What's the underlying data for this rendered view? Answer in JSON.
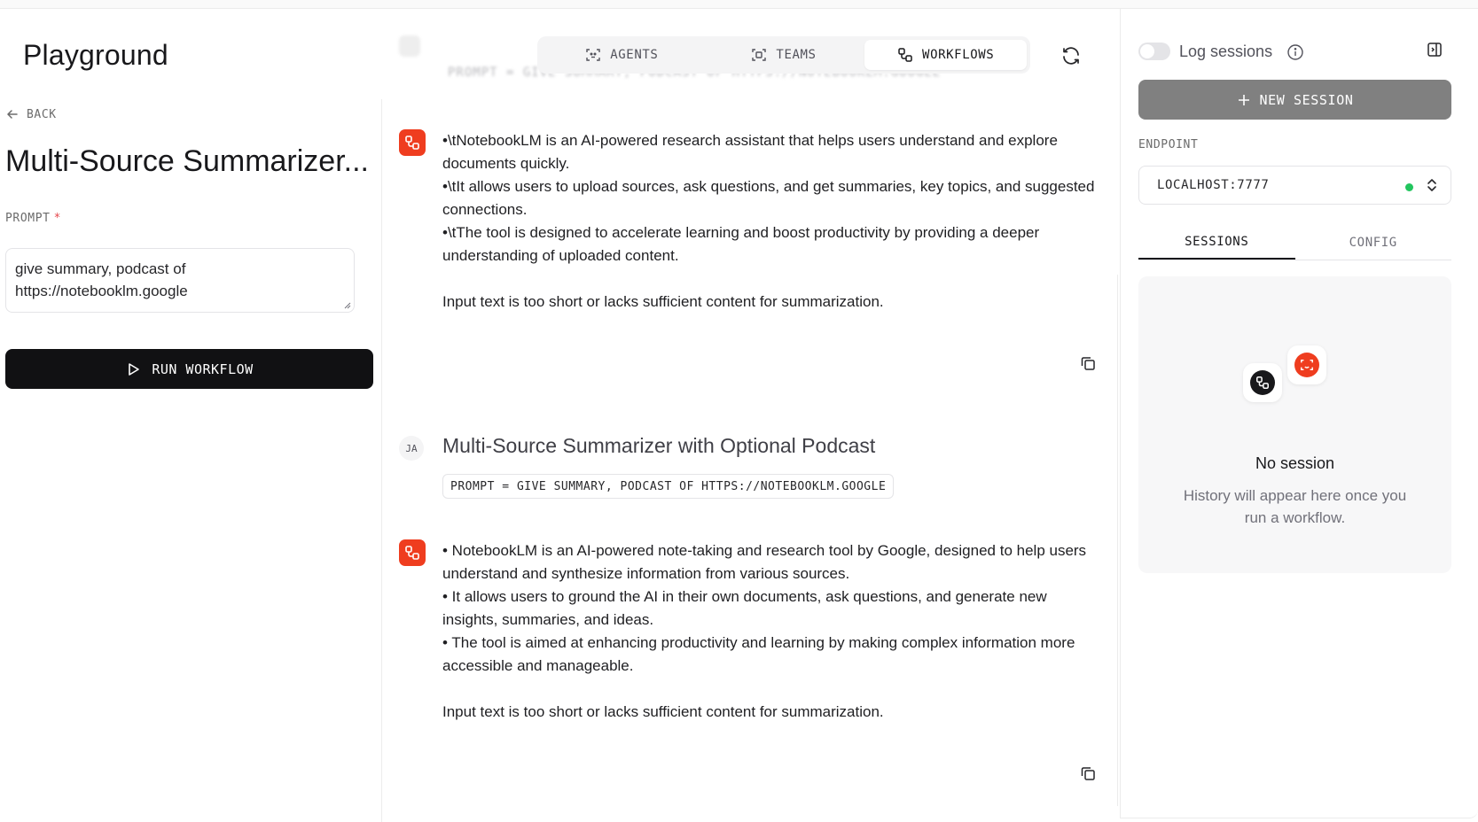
{
  "app": {
    "title": "Playground"
  },
  "left": {
    "back_label": "BACK",
    "workflow_title": "Multi-Source Summarizer...",
    "prompt_label": "PROMPT",
    "prompt_required_mark": "*",
    "prompt_value_line1": "give summary, podcast of",
    "prompt_value_line2": "https://notebooklm.google",
    "run_button_label": "RUN WORKFLOW"
  },
  "tabs": [
    {
      "label": "AGENTS",
      "icon": "agent-icon",
      "active": false
    },
    {
      "label": "TEAMS",
      "icon": "team-icon",
      "active": false
    },
    {
      "label": "WORKFLOWS",
      "icon": "workflow-icon",
      "active": true
    }
  ],
  "chat": {
    "ghost_text": "PROMPT = GIVE SUMMARY, PODCAST OF HTTPS://NOTEBOOKLM.GOOGLE",
    "response1": [
      "•\\tNotebookLM is an AI-powered research assistant that helps users understand and explore documents quickly.",
      "•\\tIt allows users to upload sources, ask questions, and get summaries, key topics, and suggested connections.",
      "•\\tThe tool is designed to accelerate learning and boost productivity by providing a deeper understanding of uploaded content.",
      "",
      "Input text is too short or lacks sufficient content for summarization."
    ],
    "user_initials": "JA",
    "user_title": "Multi-Source Summarizer with Optional Podcast",
    "user_prompt_chip": "PROMPT = GIVE SUMMARY, PODCAST OF HTTPS://NOTEBOOKLM.GOOGLE",
    "response2": [
      "• NotebookLM is an AI-powered note-taking and research tool by Google, designed to help users understand and synthesize information from various sources.",
      "• It allows users to ground the AI in their own documents, ask questions, and generate new insights, summaries, and ideas.",
      "• The tool is aimed at enhancing productivity and learning by making complex information more accessible and manageable.",
      "",
      "Input text is too short or lacks sufficient content for summarization."
    ]
  },
  "right": {
    "log_sessions_label": "Log sessions",
    "log_sessions_enabled": false,
    "new_session_label": "NEW SESSION",
    "endpoint_label": "ENDPOINT",
    "endpoint_value": "LOCALHOST:7777",
    "endpoint_status_color": "#22c55e",
    "tabs": [
      {
        "label": "SESSIONS",
        "active": true
      },
      {
        "label": "CONFIG",
        "active": false
      }
    ],
    "empty_title": "No session",
    "empty_subtitle": "History will appear here once you run a workflow."
  },
  "colors": {
    "accent": "#ef3d1f",
    "primary_button": "#111113",
    "new_session_button": "#808080"
  }
}
